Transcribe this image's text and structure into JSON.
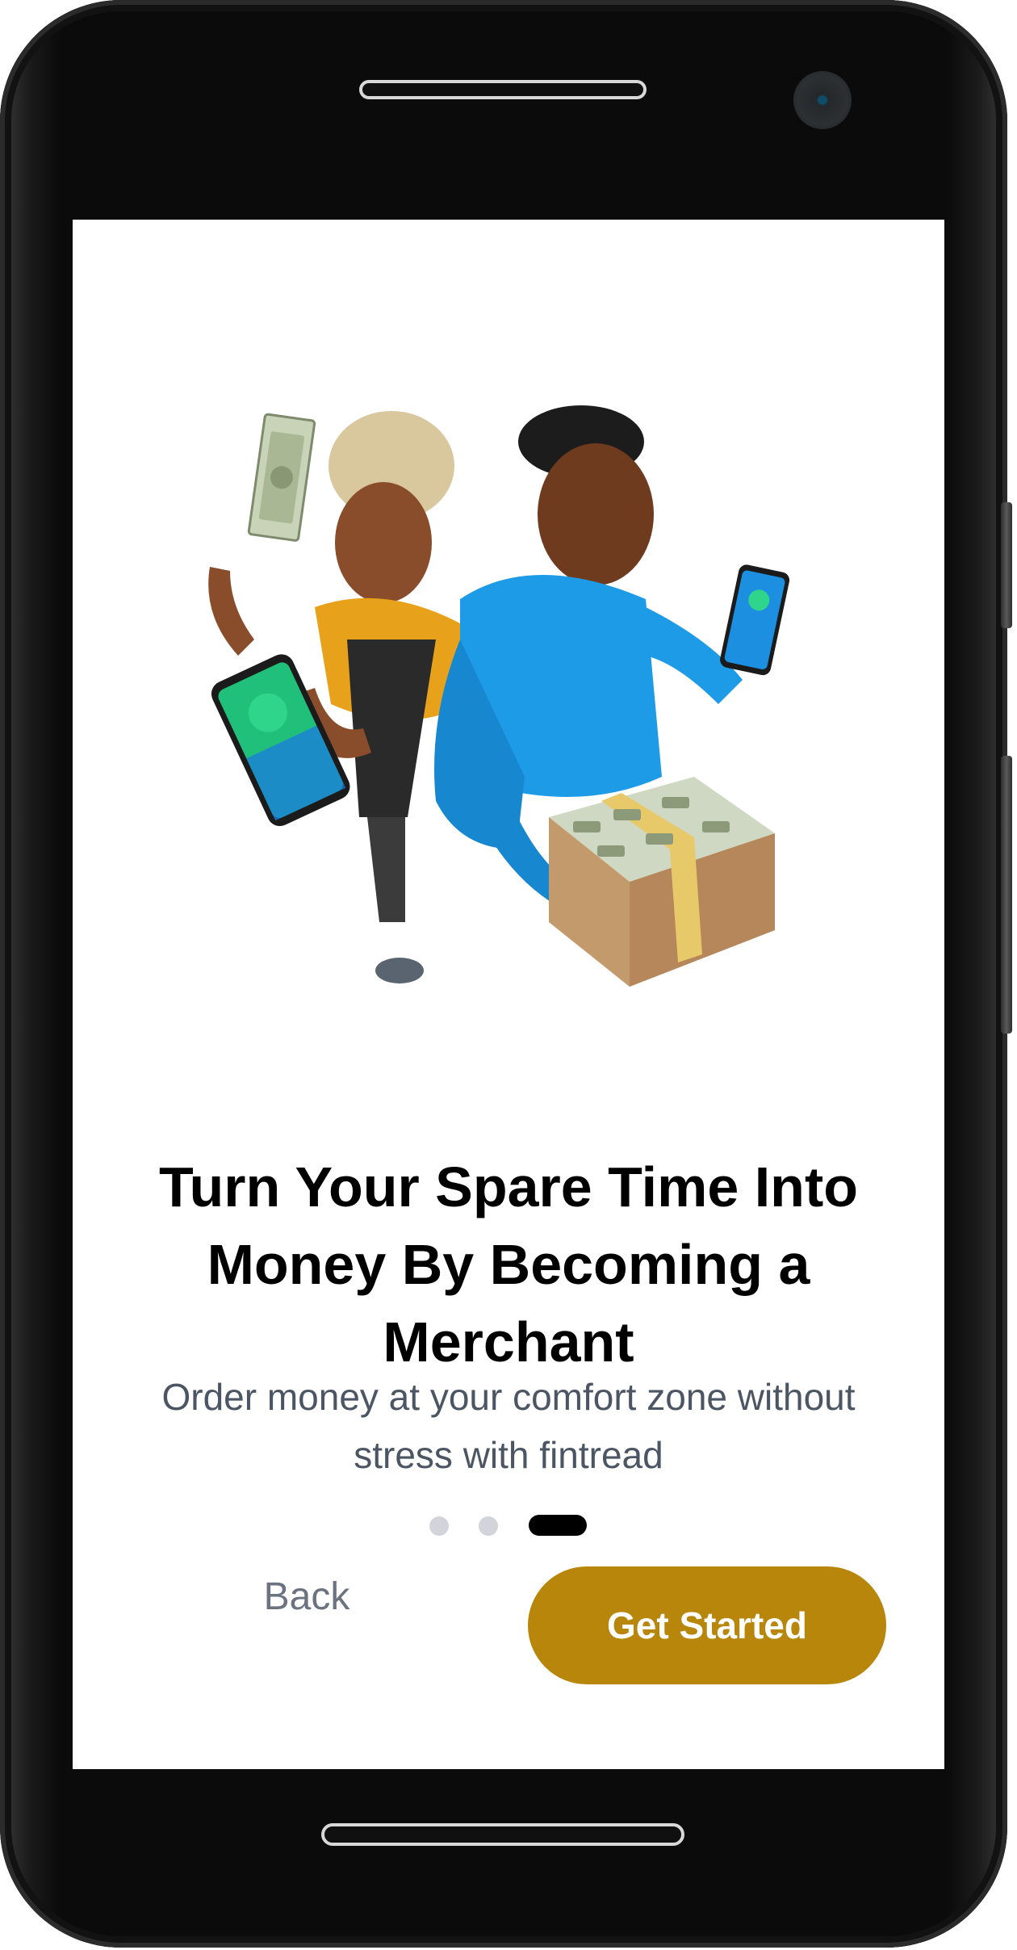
{
  "onboarding": {
    "title": "Turn Your Spare Time Into Money By Becoming a Merchant",
    "subtitle": "Order money at your comfort zone without stress with fintread",
    "pagination": {
      "total": 3,
      "active": 3
    },
    "back_label": "Back",
    "cta_label": "Get Started"
  },
  "colors": {
    "accent": "#b8860b",
    "title": "#000000",
    "subtitle": "#4b5563",
    "dot_inactive": "#d1d5db",
    "dot_active": "#000000"
  },
  "icons": {
    "hero": "merchants-illustration",
    "camera": "camera-icon",
    "speaker": "speaker-grille"
  }
}
